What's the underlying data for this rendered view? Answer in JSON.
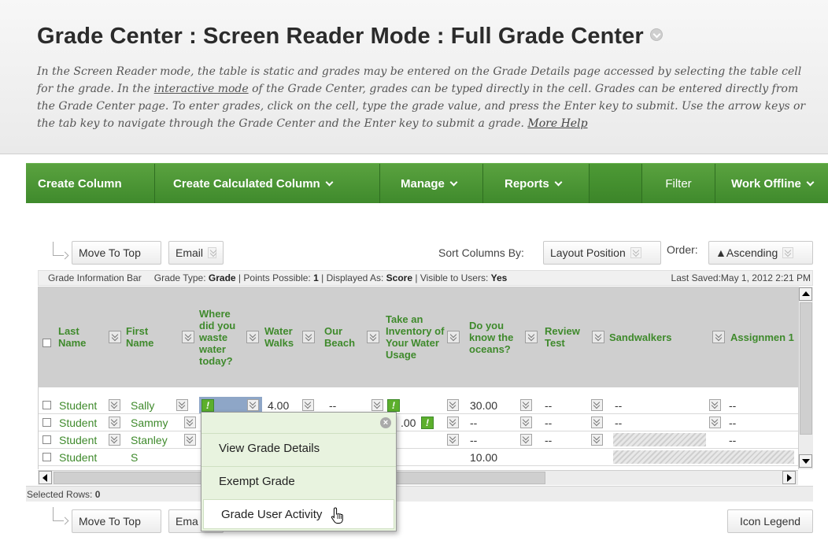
{
  "page": {
    "title": "Grade Center : Screen Reader Mode : Full Grade Center",
    "desc_p1": "In the Screen Reader mode, the table is static and grades may be entered on the Grade Details page accessed by selecting the table cell for the grade. In the ",
    "desc_link": "interactive mode",
    "desc_p2": " of the Grade Center, grades can be typed directly in the cell. Grades can be entered directly from the Grade Center page. To enter grades, click on the cell, type the grade value, and press the Enter key to submit. Use the arrow keys or the tab key to navigate through the Grade Center and the Enter key to submit a grade. ",
    "more_help": "More Help"
  },
  "actions": {
    "create_column": "Create Column",
    "create_calculated": "Create Calculated Column",
    "manage": "Manage",
    "reports": "Reports",
    "filter": "Filter",
    "work_offline": "Work Offline"
  },
  "toolbar": {
    "move_top": "Move To Top",
    "email": "Email",
    "sort_label": "Sort Columns By:",
    "sort_value": "Layout Position",
    "order_label": "Order:",
    "order_value": "▲Ascending",
    "icon_legend": "Icon Legend",
    "email_bottom": "Ema"
  },
  "infobar": {
    "label": "Grade Information Bar",
    "type_label": "Grade Type:",
    "type_value": "Grade",
    "points_label": "Points Possible:",
    "points_value": "1",
    "display_label": "Displayed As:",
    "display_value": "Score",
    "visible_label": "Visible to Users:",
    "visible_value": "Yes",
    "last_saved": "Last Saved:May 1, 2012 2:21 PM"
  },
  "grid": {
    "headers": {
      "last": "Last Name",
      "first": "First Name",
      "waste": "Where did you waste water today?",
      "walks": "Water Walks",
      "beach": "Our Beach",
      "inventory": "Take an Inventory of Your Water Usage",
      "oceans": "Do you know the oceans?",
      "review": "Review Test",
      "sandwalkers": "Sandwalkers",
      "assignment": "Assignmen 1"
    },
    "rows": [
      {
        "last": "Student",
        "first": "Sally",
        "walks": "4.00",
        "beach": "--",
        "oceans": "30.00",
        "review": "--",
        "sand": "--",
        "asg": "--"
      },
      {
        "last": "Student",
        "first": "Sammy",
        "inv_partial": ".00",
        "oceans": "--",
        "review": "--",
        "sand": "--",
        "asg": "--"
      },
      {
        "last": "Student",
        "first": "Stanley",
        "oceans": "--",
        "review": "--",
        "asg": "--"
      },
      {
        "last": "Student",
        "first": "S",
        "oceans": "10.00"
      }
    ]
  },
  "selected_rows": {
    "label": "Selected Rows:",
    "value": "0"
  },
  "popup": {
    "items": [
      "View Grade Details",
      "Exempt Grade",
      "Grade User Activity"
    ]
  },
  "colors": {
    "accent_green": "#3f8a2c",
    "bar_green": "#4f9a36",
    "header_gray": "#cfcfcf"
  }
}
